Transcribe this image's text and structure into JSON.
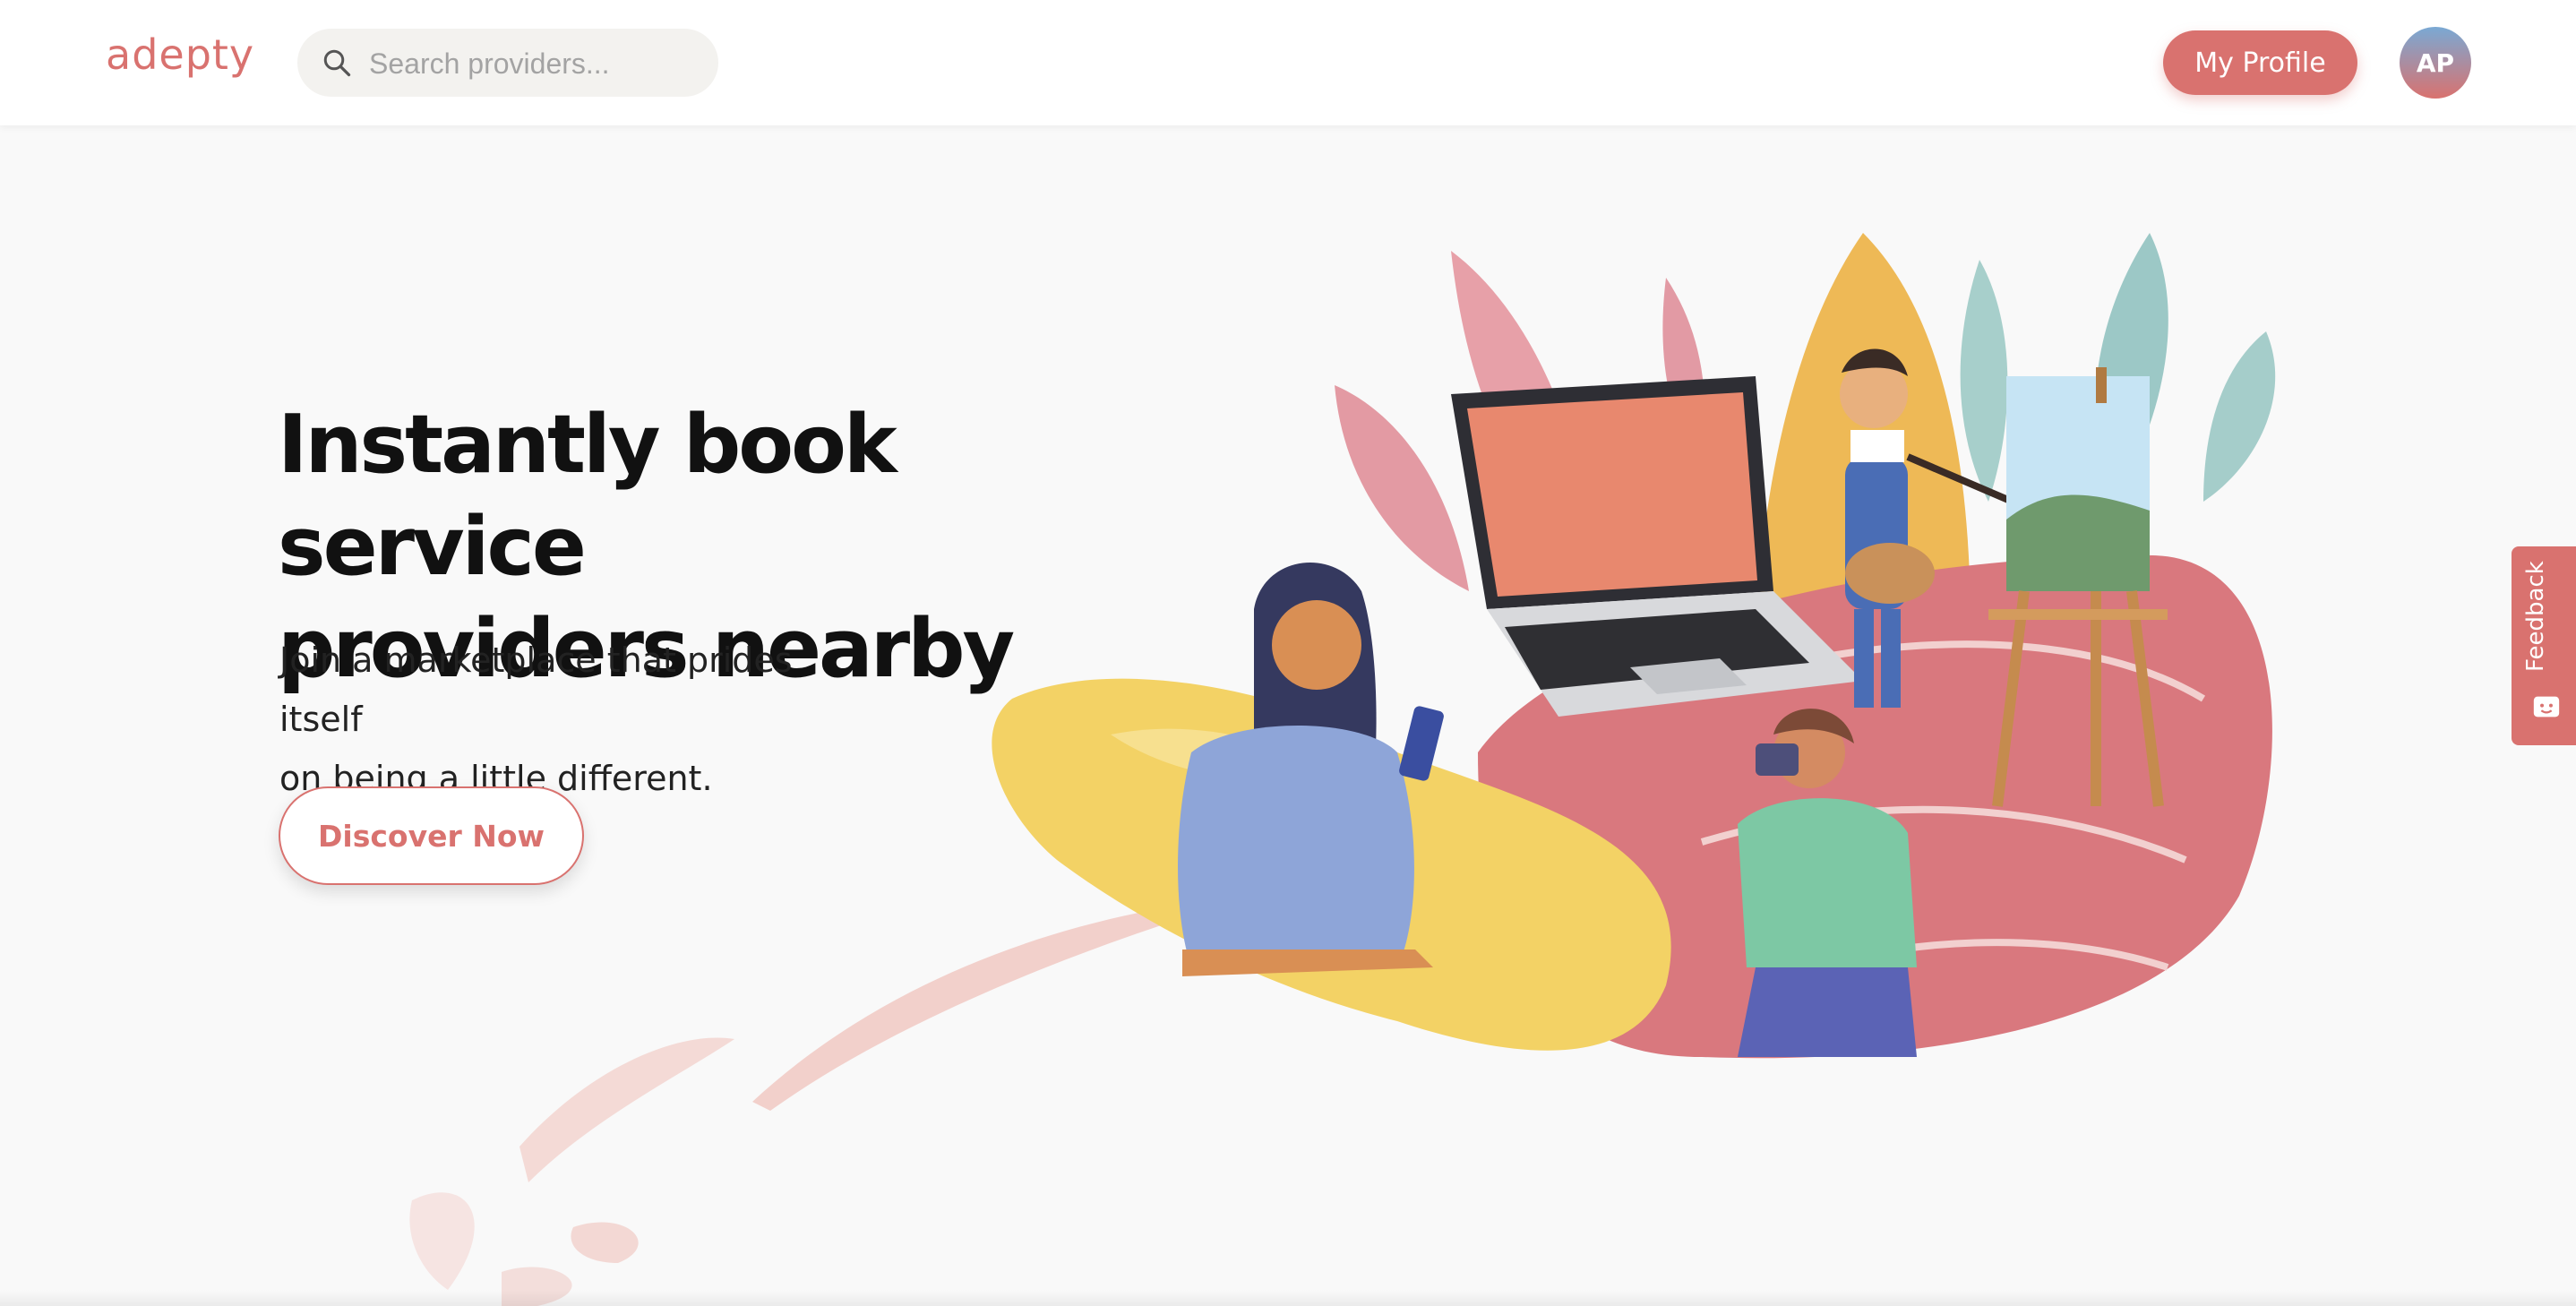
{
  "header": {
    "logo_text": "adepty",
    "search": {
      "placeholder": "Search providers..."
    },
    "profile_button_label": "My Profile",
    "avatar_initials": "AP"
  },
  "hero": {
    "title_line1": "Instantly book service",
    "title_line2": "providers nearby",
    "subtitle_line1": "Join a marketplace that prides itself",
    "subtitle_line2": "on being a little different.",
    "cta_label": "Discover Now"
  },
  "feedback_tab": {
    "label": "Feedback"
  },
  "colors": {
    "brand": "#d9726f",
    "accent_yellow": "#f2c24f",
    "accent_teal": "#8fc3c3",
    "text_dark": "#111111"
  },
  "icons": [
    "search-icon",
    "feedback-icon"
  ]
}
